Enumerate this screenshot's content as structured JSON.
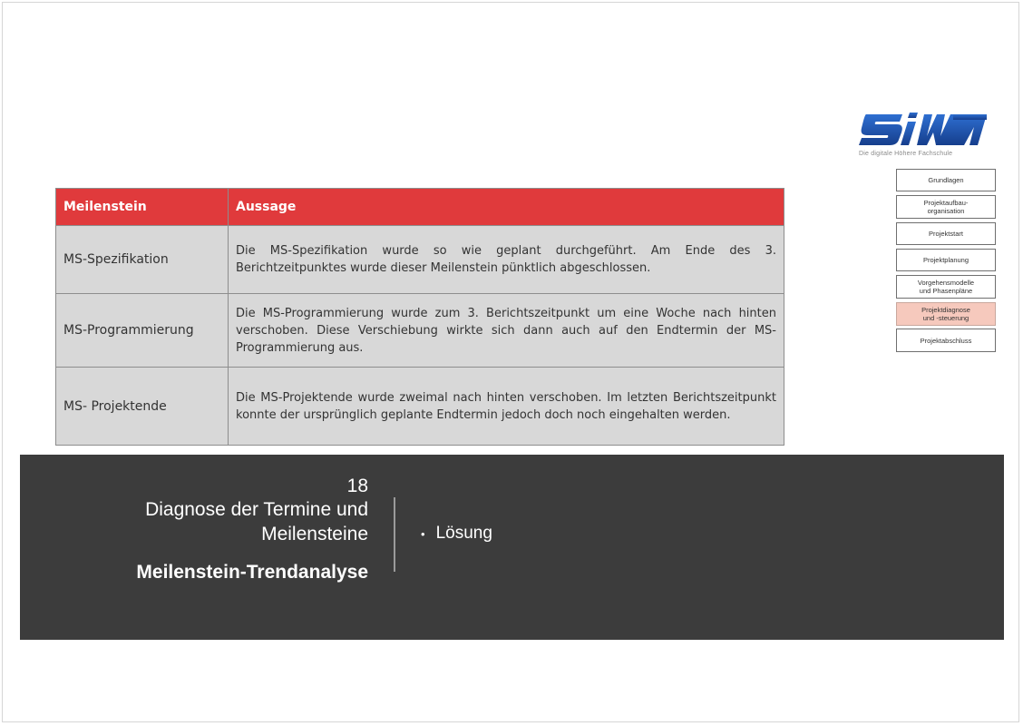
{
  "logo": {
    "name": "SIW",
    "tagline": "Die digitale Höhere Fachschule",
    "color": "#1a4fa8"
  },
  "nav": {
    "items": [
      {
        "label": "Grundlagen",
        "active": false
      },
      {
        "label": "Projektaufbau-\norganisation",
        "active": false
      },
      {
        "label": "Projektstart",
        "active": false
      },
      {
        "label": "Projektplanung",
        "active": false
      },
      {
        "label": "Vorgehensmodelle\nund Phasenpläne",
        "active": false
      },
      {
        "label": "Projektdiagnose\nund -steuerung",
        "active": true
      },
      {
        "label": "Projektabschluss",
        "active": false
      }
    ],
    "active_color": "#f6c9bd"
  },
  "table": {
    "header_color": "#e03a3c",
    "headers": [
      "Meilenstein",
      "Aussage"
    ],
    "rows": [
      {
        "milestone": "MS-Spezifikation",
        "statement": "Die MS-Spezifikation wurde so wie geplant durchgeführt. Am Ende des 3. Berichtzeitpunktes wurde dieser Meilenstein pünktlich abgeschlossen."
      },
      {
        "milestone": "MS-Programmierung",
        "statement": "Die MS-Programmierung wurde zum 3. Berichtszeitpunkt um eine Woche nach hinten verschoben. Diese Verschiebung wirkte sich dann auch auf den Endtermin der MS-Programmierung aus."
      },
      {
        "milestone": "MS- Projektende",
        "statement": "Die MS-Projektende wurde zweimal nach hinten verschoben. Im letzten Berichtszeitpunkt konnte der ursprünglich geplante Endtermin jedoch doch noch eingehalten werden."
      }
    ]
  },
  "footer": {
    "slide_number": "18",
    "section_title_line1": "Diagnose der Termine und",
    "section_title_line2": "Meilensteine",
    "subtitle": "Meilenstein-Trendanalyse",
    "bullet": "Lösung"
  }
}
